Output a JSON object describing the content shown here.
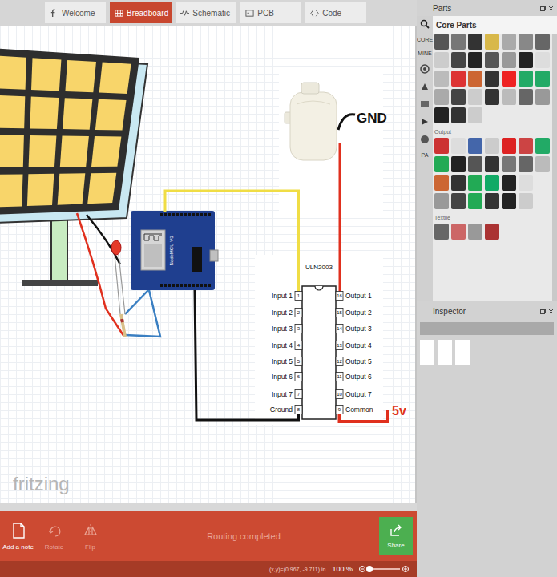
{
  "tabs": [
    {
      "label": "Welcome",
      "selected": false
    },
    {
      "label": "Breadboard",
      "selected": true
    },
    {
      "label": "Schematic",
      "selected": false
    },
    {
      "label": "PCB",
      "selected": false
    },
    {
      "label": "Code",
      "selected": false
    }
  ],
  "canvas": {
    "board_label": "NodeMCU V3",
    "pump_label": "GND",
    "supply_label": "5v",
    "chip": {
      "title": "ULN2003",
      "left_pins": [
        {
          "number": "1",
          "label": "Input 1"
        },
        {
          "number": "2",
          "label": "Input 2"
        },
        {
          "number": "3",
          "label": "Input 3"
        },
        {
          "number": "4",
          "label": "Input 4"
        },
        {
          "number": "5",
          "label": "Input 5"
        },
        {
          "number": "6",
          "label": "Input 6"
        },
        {
          "number": "7",
          "label": "Input 7"
        },
        {
          "number": "8",
          "label": "Ground"
        }
      ],
      "right_pins": [
        {
          "number": "16",
          "label": "Output 1"
        },
        {
          "number": "15",
          "label": "Output 2"
        },
        {
          "number": "14",
          "label": "Output 3"
        },
        {
          "number": "13",
          "label": "Output 4"
        },
        {
          "number": "12",
          "label": "Output 5"
        },
        {
          "number": "11",
          "label": "Output 6"
        },
        {
          "number": "10",
          "label": "Output 7"
        },
        {
          "number": "9",
          "label": "Common"
        }
      ]
    },
    "watermark": "fritzing"
  },
  "parts": {
    "title": "Parts",
    "bin_title": "Core Parts",
    "side_tabs": [
      "CORE",
      "MINE",
      "PA"
    ],
    "sections": [
      "Output",
      "Textile"
    ]
  },
  "inspector": {
    "title": "Inspector"
  },
  "toolbar": {
    "buttons": [
      {
        "label": "Add a note",
        "disabled": false
      },
      {
        "label": "Rotate",
        "disabled": true
      },
      {
        "label": "Flip",
        "disabled": true
      }
    ],
    "message": "Routing completed",
    "share": "Share"
  },
  "status_bar": {
    "coords": "(x,y)=(0.967, -9.711) in",
    "zoom": "100 %",
    "zoom_level": 0.05
  }
}
